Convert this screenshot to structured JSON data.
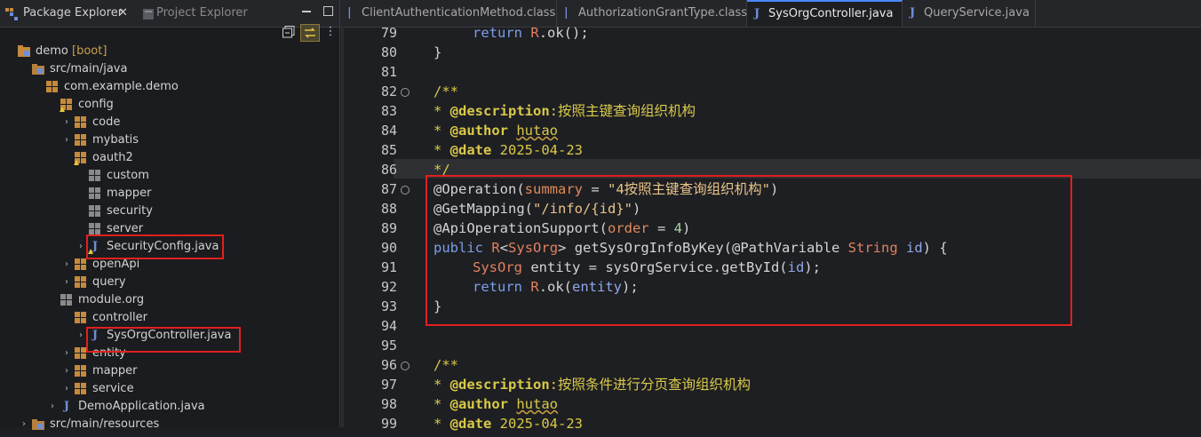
{
  "explorer": {
    "tabs": [
      {
        "label": "Package Explorer"
      },
      {
        "label": "Project Explorer"
      }
    ],
    "tree": [
      {
        "label": "demo",
        "suffix": "[boot]",
        "depth": 0,
        "icon": "project-icon",
        "twisty": "",
        "has_warn": false
      },
      {
        "label": "src/main/java",
        "depth": 1,
        "icon": "source-folder-icon",
        "twisty": "",
        "has_warn": false
      },
      {
        "label": "com.example.demo",
        "depth": 2,
        "icon": "package-icon",
        "twisty": "",
        "has_warn": false
      },
      {
        "label": "config",
        "depth": 3,
        "icon": "package-icon",
        "twisty": "",
        "has_warn": true
      },
      {
        "label": "code",
        "depth": 4,
        "icon": "package-icon",
        "twisty": "›",
        "has_warn": false
      },
      {
        "label": "mybatis",
        "depth": 4,
        "icon": "package-icon",
        "twisty": "›",
        "has_warn": false
      },
      {
        "label": "oauth2",
        "depth": 4,
        "icon": "package-icon",
        "twisty": "",
        "has_warn": true
      },
      {
        "label": "custom",
        "depth": 5,
        "icon": "empty-package-icon",
        "twisty": "",
        "has_warn": false
      },
      {
        "label": "mapper",
        "depth": 5,
        "icon": "empty-package-icon",
        "twisty": "",
        "has_warn": false
      },
      {
        "label": "security",
        "depth": 5,
        "icon": "empty-package-icon",
        "twisty": "",
        "has_warn": false
      },
      {
        "label": "server",
        "depth": 5,
        "icon": "empty-package-icon",
        "twisty": "",
        "has_warn": false
      },
      {
        "label": "SecurityConfig.java",
        "depth": 5,
        "icon": "java-file-icon",
        "twisty": "›",
        "has_warn": true
      },
      {
        "label": "openApi",
        "depth": 4,
        "icon": "package-icon",
        "twisty": "›",
        "has_warn": false
      },
      {
        "label": "query",
        "depth": 4,
        "icon": "package-icon",
        "twisty": "›",
        "has_warn": false
      },
      {
        "label": "module.org",
        "depth": 3,
        "icon": "empty-package-icon",
        "twisty": "",
        "has_warn": false
      },
      {
        "label": "controller",
        "depth": 4,
        "icon": "package-icon",
        "twisty": "",
        "has_warn": false
      },
      {
        "label": "SysOrgController.java",
        "depth": 5,
        "icon": "java-file-icon",
        "twisty": "›",
        "has_warn": false
      },
      {
        "label": "entity",
        "depth": 4,
        "icon": "package-icon",
        "twisty": "›",
        "has_warn": false
      },
      {
        "label": "mapper",
        "depth": 4,
        "icon": "package-icon",
        "twisty": "›",
        "has_warn": false
      },
      {
        "label": "service",
        "depth": 4,
        "icon": "package-icon",
        "twisty": "›",
        "has_warn": false
      },
      {
        "label": "DemoApplication.java",
        "depth": 3,
        "icon": "java-file-icon",
        "twisty": "›",
        "has_warn": false
      },
      {
        "label": "src/main/resources",
        "depth": 1,
        "icon": "source-folder-icon",
        "twisty": "›",
        "has_warn": false
      }
    ]
  },
  "editor": {
    "tabs": [
      {
        "label": "ClientAuthenticationMethod.class",
        "active": false
      },
      {
        "label": "AuthorizationGrantType.class",
        "active": false
      },
      {
        "label": "SysOrgController.java",
        "active": true
      },
      {
        "label": "QueryService.java",
        "active": false
      }
    ],
    "line_numbers": [
      "79",
      "80",
      "81",
      "82",
      "83",
      "84",
      "85",
      "86",
      "87",
      "88",
      "89",
      "90",
      "91",
      "92",
      "93",
      "94",
      "95",
      "96",
      "97",
      "98",
      "99"
    ],
    "fold_markers": [
      "82",
      "87",
      "96"
    ],
    "code": {
      "l79_kw": "return",
      "l79_r": "R",
      "l79_rest": ".ok();",
      "l80": "}",
      "l82": "/**",
      "l83_star": "* ",
      "l83_tag": "@description",
      "l83_text": ":按照主键查询组织机构",
      "l84_star": "* ",
      "l84_tag": "@author",
      "l84_text": "hutao",
      "l85_star": "* ",
      "l85_tag": "@date",
      "l85_text": " 2025-04-23",
      "l86": "*/",
      "l87_a": "@Operation(",
      "l87_p": "summary",
      "l87_eq": " = ",
      "l87_s": "\"4按照主键查询组织机构\"",
      "l87_e": ")",
      "l88_a": "@GetMapping(",
      "l88_s": "\"/info/{id}\"",
      "l88_e": ")",
      "l89_a": "@ApiOperationSupport(",
      "l89_p": "order",
      "l89_eq": " = ",
      "l89_n": "4",
      "l89_e": ")",
      "l90_kw": "public",
      "l90_r": "R",
      "l90_lt": "<",
      "l90_t": "SysOrg",
      "l90_gt": "> getSysOrgInfoByKey(@PathVariable ",
      "l90_st": "String",
      "l90_id": " id",
      "l90_e": ") {",
      "l91_t": "SysOrg",
      "l91_rest": " entity = sysOrgService.getById(",
      "l91_id": "id",
      "l91_e": ");",
      "l92_kw": "return",
      "l92_r": "R",
      "l92_mid": ".ok(",
      "l92_v": "entity",
      "l92_e": ");",
      "l93": "}",
      "l96": "/**",
      "l97_star": "* ",
      "l97_tag": "@description",
      "l97_text": ":按照条件进行分页查询组织机构",
      "l98_star": "* ",
      "l98_tag": "@author",
      "l98_text": "hutao",
      "l99_star": "* ",
      "l99_tag": "@date",
      "l99_text": " 2025-04-23"
    }
  },
  "colors": {
    "highlight_box": "#e0201f",
    "active_tab_accent": "#4a88ff"
  }
}
